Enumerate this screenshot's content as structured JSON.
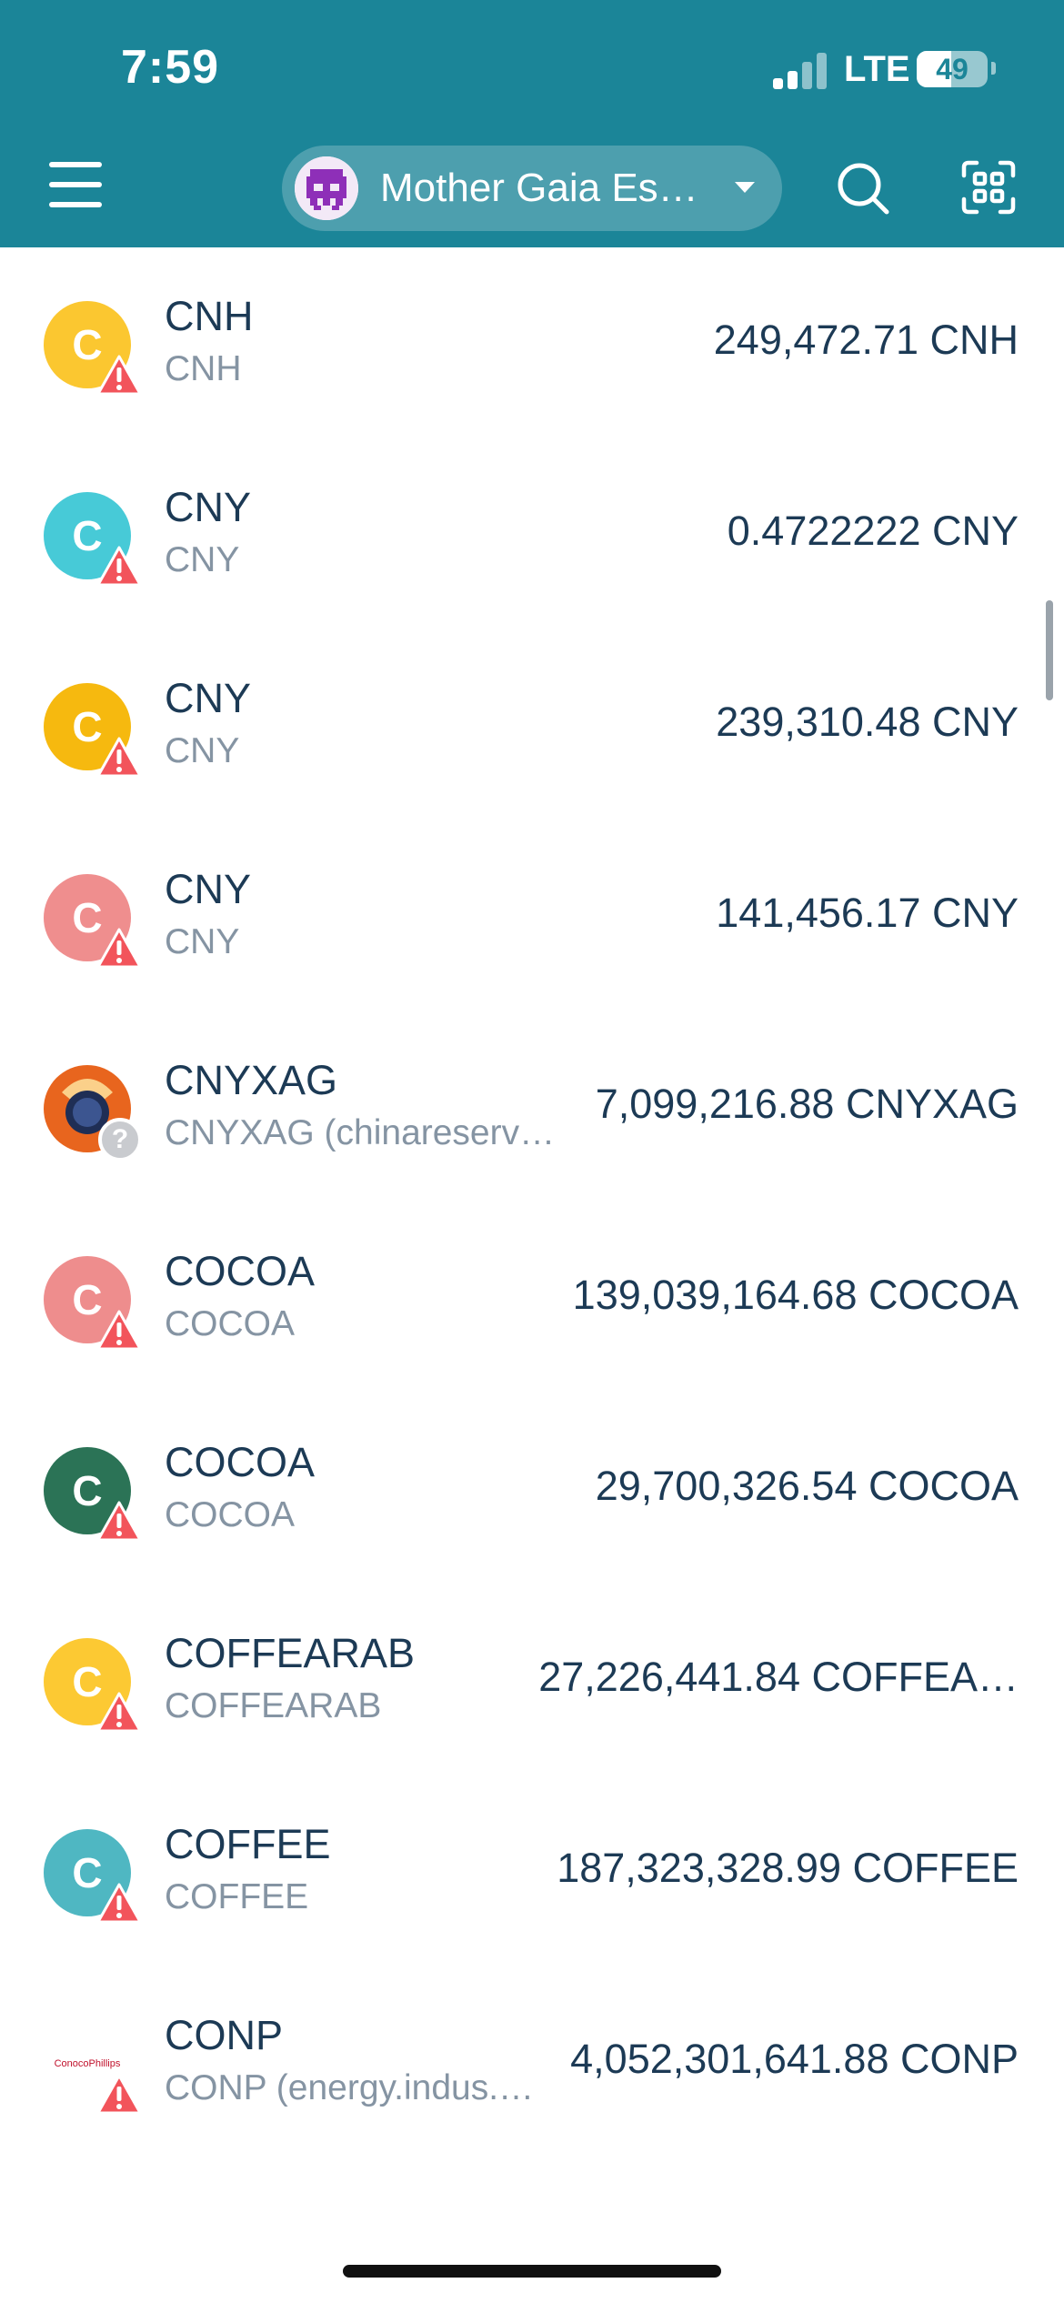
{
  "status_bar": {
    "time": "7:59",
    "network": "LTE",
    "battery": "49",
    "battery_level": 0.49
  },
  "header": {
    "account_name": "Mother Gaia Es…",
    "menu_icon": "hamburger-menu-icon",
    "search_icon": "search-icon",
    "scan_icon": "qr-scan-icon"
  },
  "tokens": [
    {
      "code": "CNH",
      "subtitle": "CNH",
      "balance": "249,472.71 CNH",
      "icon_letter": "C",
      "icon_color": "#fbc730",
      "badge": "warning"
    },
    {
      "code": "CNY",
      "subtitle": "CNY",
      "balance": "0.4722222 CNY",
      "icon_letter": "C",
      "icon_color": "#47cad7",
      "badge": "warning"
    },
    {
      "code": "CNY",
      "subtitle": "CNY",
      "balance": "239,310.48 CNY",
      "icon_letter": "C",
      "icon_color": "#f6b90f",
      "badge": "warning"
    },
    {
      "code": "CNY",
      "subtitle": "CNY",
      "balance": "141,456.17 CNY",
      "icon_letter": "C",
      "icon_color": "#ef8e8e",
      "badge": "warning"
    },
    {
      "code": "CNYXAG",
      "subtitle": "CNYXAG (chinareserve…",
      "balance": "7,099,216.88 CNYXAG",
      "icon_letter": "",
      "icon_color": "#e8651e",
      "badge": "unknown"
    },
    {
      "code": "COCOA",
      "subtitle": "COCOA",
      "balance": "139,039,164.68 COCOA",
      "icon_letter": "C",
      "icon_color": "#ee8d8d",
      "badge": "warning"
    },
    {
      "code": "COCOA",
      "subtitle": "COCOA",
      "balance": "29,700,326.54 COCOA",
      "icon_letter": "C",
      "icon_color": "#2b7356",
      "badge": "warning"
    },
    {
      "code": "COFFEARAB",
      "subtitle": "COFFEARAB",
      "balance": "27,226,441.84 COFFEA…",
      "icon_letter": "C",
      "icon_color": "#fcc933",
      "badge": "warning"
    },
    {
      "code": "COFFEE",
      "subtitle": "COFFEE",
      "balance": "187,323,328.99 COFFEE",
      "icon_letter": "C",
      "icon_color": "#4fb7c2",
      "badge": "warning"
    },
    {
      "code": "CONP",
      "subtitle": "CONP (energy.indus.…",
      "balance": "4,052,301,641.88 CONP",
      "icon_letter": "",
      "icon_color": "#ffffff",
      "badge": "warning",
      "logo_text": "ConocoPhillips"
    }
  ]
}
